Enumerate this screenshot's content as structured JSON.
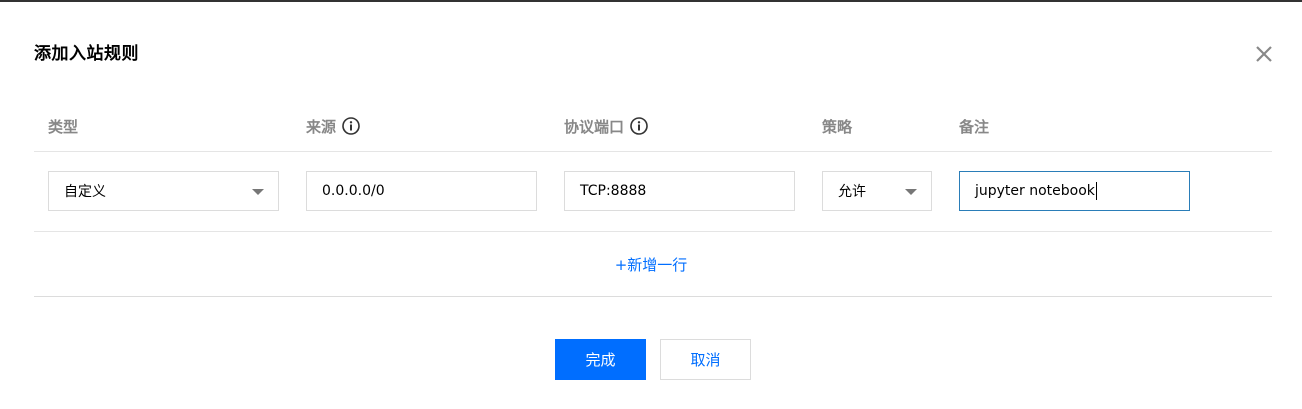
{
  "dialog": {
    "title": "添加入站规则",
    "close_icon": "close-icon"
  },
  "table": {
    "headers": {
      "type": "类型",
      "source": "来源",
      "port": "协议端口",
      "policy": "策略",
      "remark": "备注"
    },
    "row": {
      "type_value": "自定义",
      "source_value": "0.0.0.0/0",
      "port_value": "TCP:8888",
      "policy_value": "允许",
      "remark_value": "jupyter notebook"
    },
    "add_row_label": "+新增一行"
  },
  "footer": {
    "confirm_label": "完成",
    "cancel_label": "取消"
  },
  "colors": {
    "primary": "#006eff",
    "focus_border": "#2a7db8",
    "header_text": "#888888"
  }
}
